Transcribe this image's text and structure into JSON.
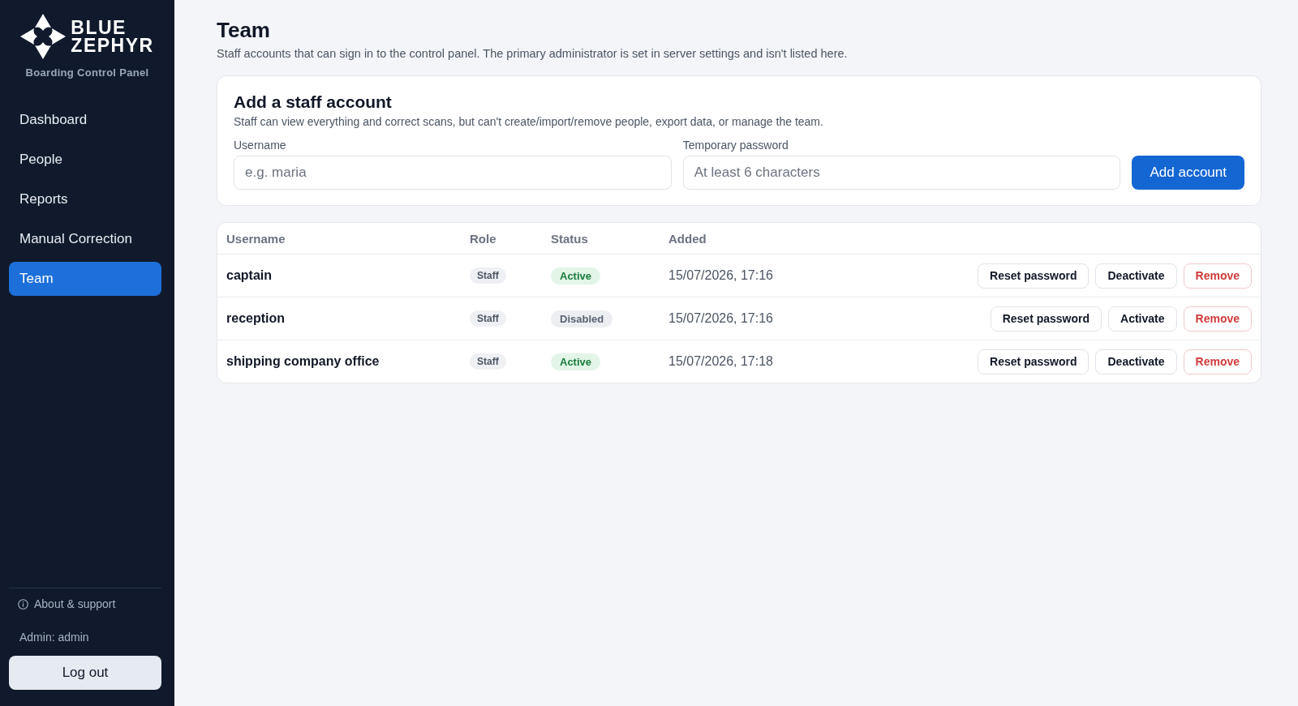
{
  "sidebar": {
    "brand": {
      "wordmark": "BLUE ZEPHYR",
      "subtitle": "Boarding Control Panel"
    },
    "nav": [
      {
        "label": "Dashboard",
        "selected": false
      },
      {
        "label": "People",
        "selected": false
      },
      {
        "label": "Reports",
        "selected": false
      },
      {
        "label": "Manual Correction",
        "selected": false
      },
      {
        "label": "Team",
        "selected": true
      }
    ],
    "footer": {
      "about_link": "About & support",
      "signed_in_as": "Admin: admin",
      "logout_button": "Log out"
    }
  },
  "page": {
    "title": "Team",
    "description": "Staff accounts that can sign in to the control panel. The primary administrator is set in server settings and isn't listed here."
  },
  "add_form": {
    "title": "Add a staff account",
    "description": "Staff can view everything and correct scans, but can't create/import/remove people, export data, or manage the team.",
    "fields": [
      {
        "label": "Username",
        "placeholder": "e.g. maria"
      },
      {
        "label": "Temporary password",
        "placeholder": "At least 6 characters"
      }
    ],
    "submit_button": "Add account"
  },
  "table": {
    "columns": [
      "Username",
      "Role",
      "Status",
      "Added"
    ],
    "rows": [
      {
        "username": "captain",
        "role": "Staff",
        "status": "Active",
        "active": true,
        "added": "15/07/2026, 17:16",
        "actions": [
          {
            "label": "Reset password",
            "kind": "secondary"
          },
          {
            "label": "Deactivate",
            "kind": "secondary"
          },
          {
            "label": "Remove",
            "kind": "danger"
          }
        ]
      },
      {
        "username": "reception",
        "role": "Staff",
        "status": "Disabled",
        "active": false,
        "added": "15/07/2026, 17:16",
        "actions": [
          {
            "label": "Reset password",
            "kind": "secondary"
          },
          {
            "label": "Activate",
            "kind": "secondary"
          },
          {
            "label": "Remove",
            "kind": "danger"
          }
        ]
      },
      {
        "username": "shipping company office",
        "role": "Staff",
        "status": "Active",
        "active": true,
        "added": "15/07/2026, 17:18",
        "actions": [
          {
            "label": "Reset password",
            "kind": "secondary"
          },
          {
            "label": "Deactivate",
            "kind": "secondary"
          },
          {
            "label": "Remove",
            "kind": "danger"
          }
        ]
      }
    ]
  }
}
